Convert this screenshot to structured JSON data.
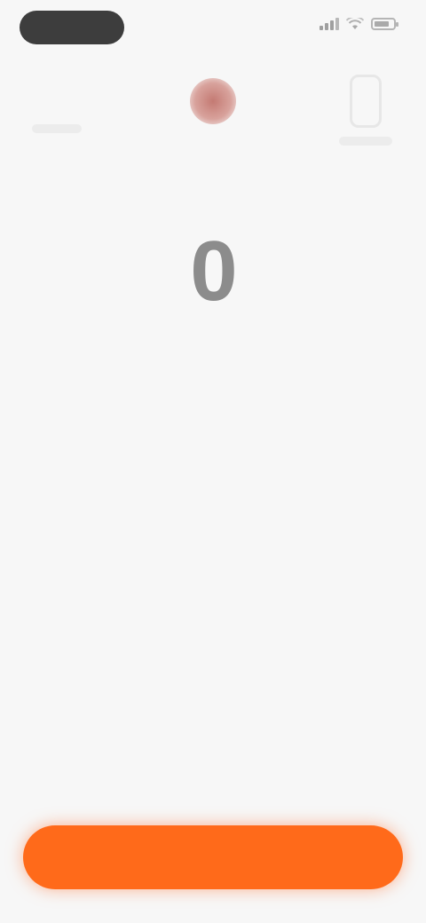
{
  "status_bar": {
    "time": "",
    "icons": [
      "signal-icon",
      "wifi-icon",
      "battery-icon"
    ]
  },
  "top_nav": {
    "left_label": "",
    "center_label": "",
    "center_icon": "record-dot-icon",
    "right_icon": "phone-outline-icon",
    "right_label": ""
  },
  "timer": {
    "value": "0",
    "subtitle": ""
  },
  "empty_state": {
    "title": "",
    "description": ""
  },
  "primary_button": {
    "label": ""
  },
  "colors": {
    "background": "#f7f7f7",
    "accent": "#ff6a1a",
    "record_dot": "#c47a73",
    "timer_text": "#8c8c8c"
  }
}
